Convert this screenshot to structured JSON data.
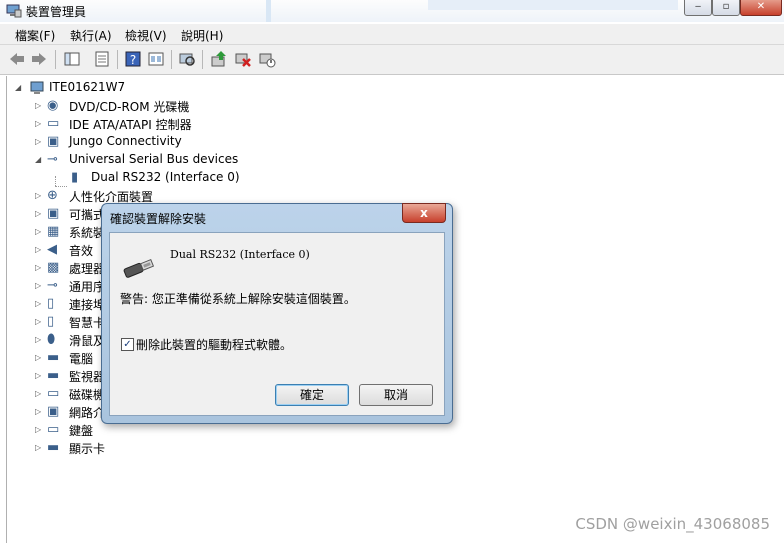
{
  "window": {
    "title": "裝置管理員",
    "controls": [
      "minimize",
      "maximize",
      "close"
    ]
  },
  "menu": [
    {
      "label": "檔案(F)"
    },
    {
      "label": "執行(A)"
    },
    {
      "label": "檢視(V)"
    },
    {
      "label": "說明(H)"
    }
  ],
  "toolbar": [
    "back-icon",
    "forward-icon",
    "console-tree-icon",
    "properties-icon",
    "help-icon",
    "view-icon",
    "scan-hardware-icon",
    "update-driver-icon",
    "uninstall-icon",
    "disable-icon"
  ],
  "tree": {
    "root": "ITE01621W7",
    "nodes": [
      {
        "label": "DVD/CD-ROM 光碟機",
        "icon": "dvd-icon"
      },
      {
        "label": "IDE ATA/ATAPI 控制器",
        "icon": "ide-controller-icon"
      },
      {
        "label": "Jungo Connectivity",
        "icon": "jungo-icon"
      },
      {
        "label": "Universal Serial Bus devices",
        "icon": "usb-icon"
      },
      {
        "label": "Dual RS232 (Interface 0)",
        "icon": "usb-plug-icon"
      },
      {
        "label": "人性化介面裝置",
        "icon": "hid-icon"
      },
      {
        "label": "可攜式",
        "icon": "portable-device-icon"
      },
      {
        "label": "系統裝",
        "icon": "system-device-icon"
      },
      {
        "label": "音效",
        "icon": "sound-icon"
      },
      {
        "label": "處理器",
        "icon": "processor-icon"
      },
      {
        "label": "通用序",
        "icon": "usb-controller-icon"
      },
      {
        "label": "連接埠",
        "icon": "port-icon"
      },
      {
        "label": "智慧卡",
        "icon": "smartcard-icon"
      },
      {
        "label": "滑鼠及",
        "icon": "mouse-icon"
      },
      {
        "label": "電腦",
        "icon": "computer-icon"
      },
      {
        "label": "監視器",
        "icon": "monitor-icon"
      },
      {
        "label": "磁碟機",
        "icon": "disk-icon"
      },
      {
        "label": "網路介",
        "icon": "network-icon"
      },
      {
        "label": "鍵盤",
        "icon": "keyboard-icon"
      },
      {
        "label": "顯示卡",
        "icon": "display-adapter-icon"
      }
    ]
  },
  "dialog": {
    "title": "確認裝置解除安裝",
    "close_label": "x",
    "device_name": "Dual RS232 (Interface 0)",
    "warning": "警告: 您正準備從系統上解除安裝這個裝置。",
    "checkbox_label": "刪除此裝置的驅動程式軟體。",
    "checkbox_checked": true,
    "checkbox_mark": "✓",
    "ok_label": "確定",
    "cancel_label": "取消"
  },
  "watermark": "CSDN @weixin_43068085"
}
